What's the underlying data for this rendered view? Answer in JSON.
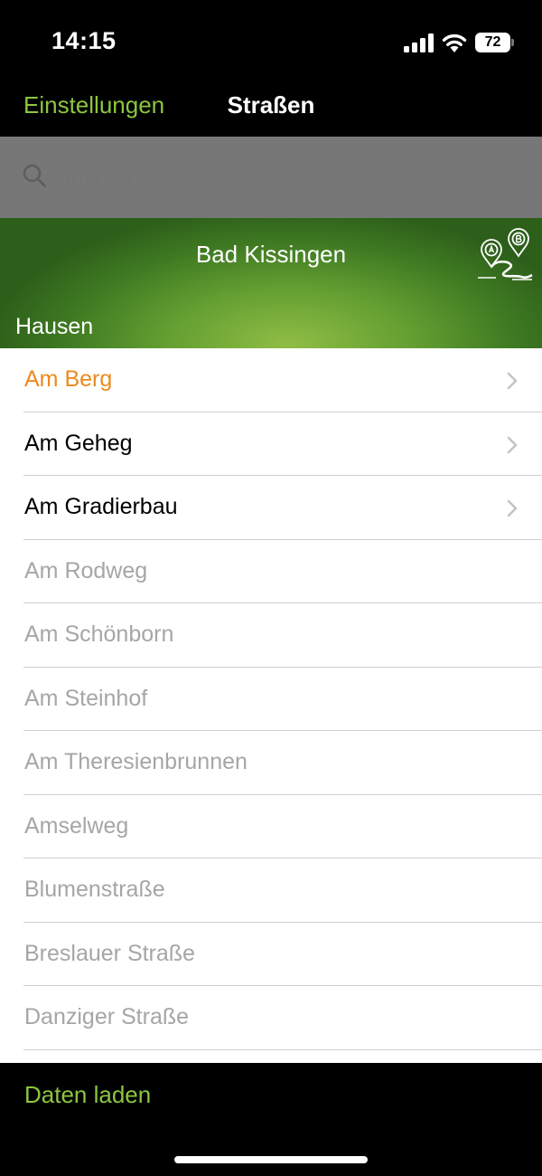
{
  "status_bar": {
    "time": "14:15",
    "battery_level": "72",
    "icons": [
      "cellular-signal-icon",
      "wifi-icon",
      "battery-icon"
    ]
  },
  "nav": {
    "back_label": "Einstellungen",
    "title": "Straßen"
  },
  "search": {
    "placeholder": "Suchen",
    "value": ""
  },
  "banner": {
    "title": "Bad Kissingen",
    "route_icon": "route-a-to-b-icon",
    "section_label": "Hausen"
  },
  "streets": [
    {
      "name": "Am Berg",
      "state": "selected",
      "has_chevron": true
    },
    {
      "name": "Am Geheg",
      "state": "active",
      "has_chevron": true
    },
    {
      "name": "Am Gradierbau",
      "state": "active",
      "has_chevron": true
    },
    {
      "name": "Am Rodweg",
      "state": "disabled",
      "has_chevron": false
    },
    {
      "name": "Am Schönborn",
      "state": "disabled",
      "has_chevron": false
    },
    {
      "name": "Am Steinhof",
      "state": "disabled",
      "has_chevron": false
    },
    {
      "name": "Am Theresienbrunnen",
      "state": "disabled",
      "has_chevron": false
    },
    {
      "name": "Amselweg",
      "state": "disabled",
      "has_chevron": false
    },
    {
      "name": "Blumenstraße",
      "state": "disabled",
      "has_chevron": false
    },
    {
      "name": "Breslauer Straße",
      "state": "disabled",
      "has_chevron": false
    },
    {
      "name": "Danziger Straße",
      "state": "disabled",
      "has_chevron": false
    },
    {
      "name": "",
      "state": "disabled",
      "has_chevron": false
    }
  ],
  "bottom": {
    "load_label": "Daten laden"
  },
  "colors": {
    "accent_green": "#8dc63f",
    "selected_orange": "#ec8a1d",
    "disabled_gray": "#a6a6a6"
  }
}
